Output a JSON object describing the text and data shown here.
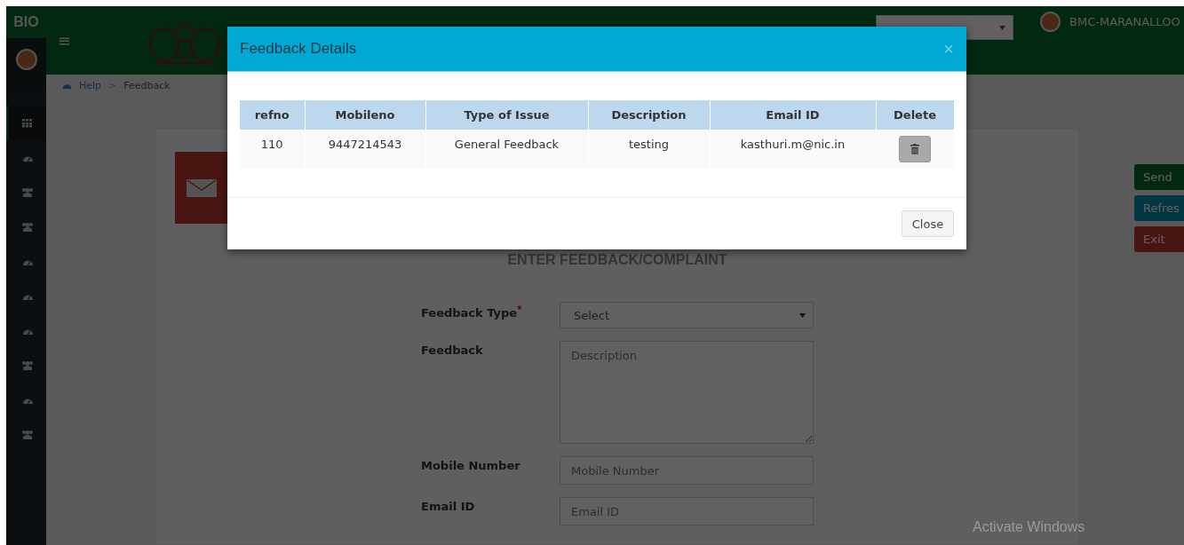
{
  "brand": "BIO",
  "sidebar": {
    "items": [
      {
        "kind": "grid",
        "selected": true
      },
      {
        "kind": "gauge",
        "selected": false
      },
      {
        "kind": "users",
        "selected": false
      },
      {
        "kind": "users",
        "selected": false
      },
      {
        "kind": "gauge",
        "selected": false
      },
      {
        "kind": "gauge",
        "selected": false
      },
      {
        "kind": "gauge",
        "selected": false
      },
      {
        "kind": "users",
        "selected": false
      },
      {
        "kind": "gauge",
        "selected": false
      },
      {
        "kind": "users",
        "selected": false
      }
    ]
  },
  "header": {
    "menu_symbol": "≡",
    "user": "BMC-MARANALLOO"
  },
  "breadcrumb": {
    "separator": ">",
    "items": [
      "Help",
      "Feedback"
    ]
  },
  "form": {
    "title": "ENTER FEEDBACK/COMPLAINT",
    "required_symbol": "*",
    "fields": [
      {
        "kind": "select",
        "label": "Feedback Type",
        "required": true,
        "value": "Select"
      },
      {
        "kind": "textarea",
        "label": "Feedback",
        "required": false,
        "placeholder": "Description"
      },
      {
        "kind": "input",
        "label": "Mobile Number",
        "required": false,
        "placeholder": "Mobile Number"
      },
      {
        "kind": "input",
        "label": "Email ID",
        "required": false,
        "placeholder": "Email ID"
      }
    ]
  },
  "actions": [
    {
      "label": "Send",
      "kind": "primary"
    },
    {
      "label": "Refres",
      "kind": "info"
    },
    {
      "label": "Exit",
      "kind": "danger"
    }
  ],
  "modal": {
    "title": "Feedback Details",
    "close_symbol": "×",
    "table": {
      "columns": [
        "refno",
        "Mobileno",
        "Type of Issue",
        "Description",
        "Email ID",
        "Delete"
      ],
      "rows": [
        [
          "110",
          "9447214543",
          "General Feedback",
          "testing",
          "kasthuri.m@nic.in"
        ]
      ]
    },
    "footer_button": "Close"
  },
  "os_notice": "Activate Windows"
}
